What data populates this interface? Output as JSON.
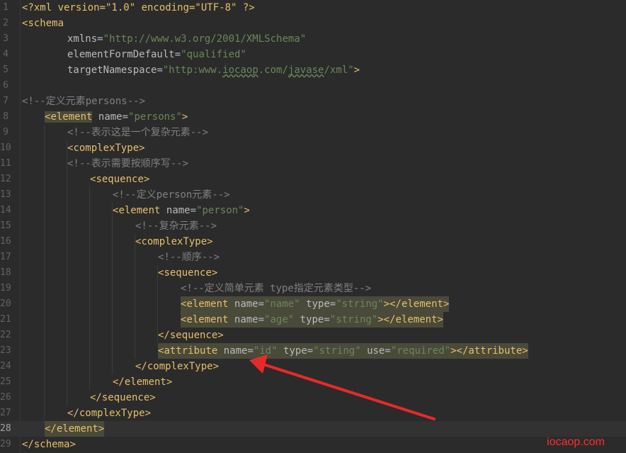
{
  "editor": {
    "language": "xml",
    "current_line": 28,
    "lines": [
      {
        "n": "1",
        "tokens": [
          [
            "pi",
            "<?xml version=\"1.0\" encoding=\"UTF-8\" ?>"
          ]
        ]
      },
      {
        "n": "2",
        "tokens": [
          [
            "br",
            "<"
          ],
          [
            "tag",
            "schema"
          ]
        ]
      },
      {
        "n": "3",
        "tokens": [
          [
            "attr",
            "xmlns"
          ],
          [
            "txt",
            "="
          ],
          [
            "val",
            "\"http://www.w3.org/2001/XMLSchema\""
          ]
        ]
      },
      {
        "n": "4",
        "tokens": [
          [
            "attr",
            "elementFormDefault"
          ],
          [
            "txt",
            "="
          ],
          [
            "val",
            "\"qualified\""
          ]
        ]
      },
      {
        "n": "5",
        "tokens": [
          [
            "attr",
            "targetNamespace"
          ],
          [
            "txt",
            "="
          ],
          [
            "val",
            "\"http:www."
          ],
          [
            "valsq",
            "iocaop"
          ],
          [
            "val",
            ".com/"
          ],
          [
            "valsq",
            "javase"
          ],
          [
            "val",
            "/xml\""
          ],
          [
            "br",
            ">"
          ]
        ]
      },
      {
        "n": "6",
        "tokens": []
      },
      {
        "n": "7",
        "tokens": [
          [
            "com",
            "<!--定义元素persons-->"
          ]
        ]
      },
      {
        "n": "8",
        "tokens": [
          [
            "brh",
            "<"
          ],
          [
            "tagh",
            "element"
          ],
          [
            "txt",
            " "
          ],
          [
            "attr",
            "name"
          ],
          [
            "txt",
            "="
          ],
          [
            "val",
            "\"persons\""
          ],
          [
            "br",
            ">"
          ]
        ]
      },
      {
        "n": "9",
        "tokens": [
          [
            "com",
            "<!--表示这是一个复杂元素-->"
          ]
        ]
      },
      {
        "n": "10",
        "tokens": [
          [
            "br",
            "<"
          ],
          [
            "tag",
            "complexType"
          ],
          [
            "br",
            ">"
          ]
        ]
      },
      {
        "n": "11",
        "tokens": [
          [
            "com",
            "<!--表示需要按顺序写-->"
          ]
        ]
      },
      {
        "n": "12",
        "tokens": [
          [
            "br",
            "<"
          ],
          [
            "tag",
            "sequence"
          ],
          [
            "br",
            ">"
          ]
        ]
      },
      {
        "n": "13",
        "tokens": [
          [
            "com",
            "<!--定义person元素-->"
          ]
        ]
      },
      {
        "n": "14",
        "tokens": [
          [
            "br",
            "<"
          ],
          [
            "tag",
            "element"
          ],
          [
            "txt",
            " "
          ],
          [
            "attr",
            "name"
          ],
          [
            "txt",
            "="
          ],
          [
            "val",
            "\"person\""
          ],
          [
            "br",
            ">"
          ]
        ]
      },
      {
        "n": "15",
        "tokens": [
          [
            "com",
            "<!--复杂元素-->"
          ]
        ]
      },
      {
        "n": "16",
        "tokens": [
          [
            "br",
            "<"
          ],
          [
            "tag",
            "complexType"
          ],
          [
            "br",
            ">"
          ]
        ]
      },
      {
        "n": "17",
        "tokens": [
          [
            "com",
            "<!--顺序-->"
          ]
        ]
      },
      {
        "n": "18",
        "tokens": [
          [
            "br",
            "<"
          ],
          [
            "tag",
            "sequence"
          ],
          [
            "br",
            ">"
          ]
        ]
      },
      {
        "n": "19",
        "tokens": [
          [
            "com",
            "<!--定义简单元素 type指定元素类型-->"
          ]
        ]
      },
      {
        "n": "20",
        "hl": true,
        "tokens": [
          [
            "br",
            "<"
          ],
          [
            "tag",
            "element"
          ],
          [
            "txt",
            " "
          ],
          [
            "attr",
            "name"
          ],
          [
            "txt",
            "="
          ],
          [
            "val",
            "\"name\""
          ],
          [
            "txt",
            " "
          ],
          [
            "attr",
            "type"
          ],
          [
            "txt",
            "="
          ],
          [
            "val",
            "\"string\""
          ],
          [
            "br",
            "></"
          ],
          [
            "tag",
            "element"
          ],
          [
            "br",
            ">"
          ]
        ]
      },
      {
        "n": "21",
        "hl": true,
        "tokens": [
          [
            "br",
            "<"
          ],
          [
            "tag",
            "element"
          ],
          [
            "txt",
            " "
          ],
          [
            "attr",
            "name"
          ],
          [
            "txt",
            "="
          ],
          [
            "val",
            "\"age\""
          ],
          [
            "txt",
            " "
          ],
          [
            "attr",
            "type"
          ],
          [
            "txt",
            "="
          ],
          [
            "val",
            "\"string\""
          ],
          [
            "br",
            "></"
          ],
          [
            "tag",
            "element"
          ],
          [
            "br",
            ">"
          ]
        ]
      },
      {
        "n": "22",
        "tokens": [
          [
            "br",
            "</"
          ],
          [
            "tag",
            "sequence"
          ],
          [
            "br",
            ">"
          ]
        ]
      },
      {
        "n": "23",
        "hl": true,
        "tokens": [
          [
            "br",
            "<"
          ],
          [
            "tag",
            "attribute"
          ],
          [
            "txt",
            " "
          ],
          [
            "attr",
            "name"
          ],
          [
            "txt",
            "="
          ],
          [
            "val",
            "\"id\""
          ],
          [
            "txt",
            " "
          ],
          [
            "attr",
            "type"
          ],
          [
            "txt",
            "="
          ],
          [
            "val",
            "\"string\""
          ],
          [
            "txt",
            " "
          ],
          [
            "attr",
            "use"
          ],
          [
            "txt",
            "="
          ],
          [
            "val",
            "\"required\""
          ],
          [
            "br",
            "></"
          ],
          [
            "tag",
            "attribute"
          ],
          [
            "br",
            ">"
          ]
        ]
      },
      {
        "n": "24",
        "tokens": [
          [
            "br",
            "</"
          ],
          [
            "tag",
            "complexType"
          ],
          [
            "br",
            ">"
          ]
        ]
      },
      {
        "n": "25",
        "tokens": [
          [
            "br",
            "</"
          ],
          [
            "tag",
            "element"
          ],
          [
            "br",
            ">"
          ]
        ]
      },
      {
        "n": "26",
        "tokens": [
          [
            "br",
            "</"
          ],
          [
            "tag",
            "sequence"
          ],
          [
            "br",
            ">"
          ]
        ]
      },
      {
        "n": "27",
        "tokens": [
          [
            "br",
            "</"
          ],
          [
            "tag",
            "complexType"
          ],
          [
            "br",
            ">"
          ]
        ]
      },
      {
        "n": "28",
        "hl": true,
        "tokens": [
          [
            "br",
            "</"
          ],
          [
            "tag",
            "element"
          ],
          [
            "br",
            ">"
          ]
        ]
      },
      {
        "n": "29",
        "tokens": [
          [
            "br",
            "</"
          ],
          [
            "tag",
            "schema"
          ],
          [
            "br",
            ">"
          ]
        ]
      }
    ]
  },
  "annotation": {
    "arrow_color": "#e8292b"
  },
  "watermark": "iocaop.com"
}
